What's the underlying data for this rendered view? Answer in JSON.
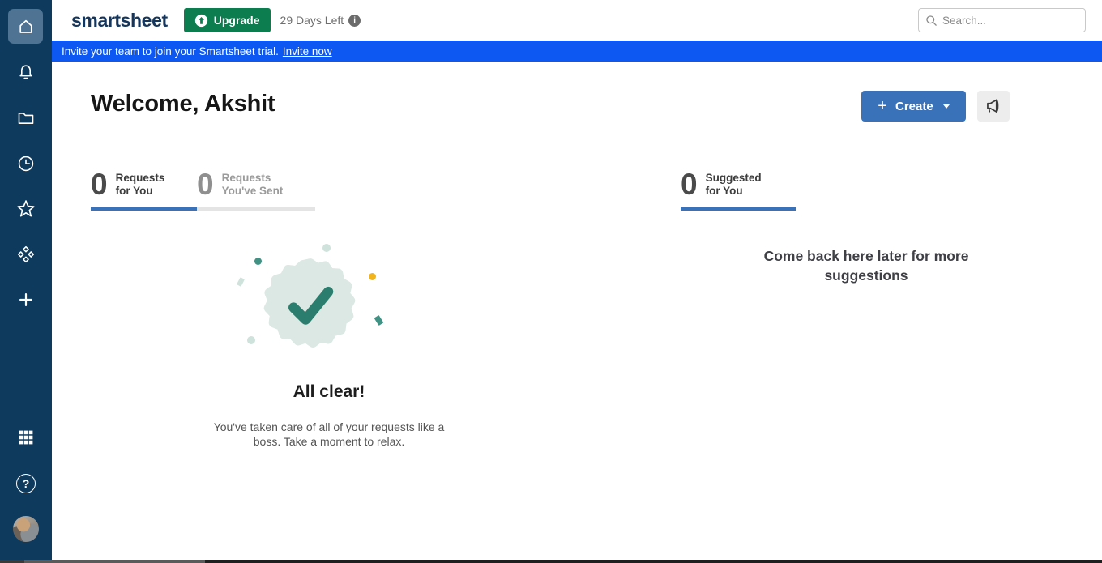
{
  "topbar": {
    "logo": "smartsheet",
    "upgrade_label": "Upgrade",
    "days_left": "29 Days Left",
    "info_glyph": "i",
    "search_placeholder": "Search..."
  },
  "banner": {
    "text": "Invite your team to join your Smartsheet trial.",
    "link_label": "Invite now"
  },
  "sidebar": {
    "items": [
      {
        "icon": "home-icon",
        "active": true
      },
      {
        "icon": "bell-icon",
        "active": false
      },
      {
        "icon": "folder-icon",
        "active": false
      },
      {
        "icon": "clock-icon",
        "active": false
      },
      {
        "icon": "star-icon",
        "active": false
      },
      {
        "icon": "solution-center-icon",
        "active": false
      },
      {
        "icon": "plus-icon",
        "active": false
      }
    ],
    "bottom_items": [
      {
        "icon": "apps-grid-icon"
      },
      {
        "icon": "help-icon",
        "glyph": "?"
      },
      {
        "icon": "user-avatar"
      }
    ]
  },
  "main": {
    "welcome_title": "Welcome, Akshit",
    "create_label": "Create",
    "create_plus": "+",
    "tabs": [
      {
        "count": "0",
        "line1": "Requests",
        "line2": "for You",
        "state": "active"
      },
      {
        "count": "0",
        "line1": "Requests",
        "line2": "You've Sent",
        "state": "inactive"
      },
      {
        "count": "0",
        "line1": "Suggested",
        "line2": "for You",
        "state": "active"
      }
    ],
    "empty_state": {
      "title": "All clear!",
      "body_line1": "You've taken care of all of your requests like a",
      "body_line2": "boss. Take a moment to relax."
    },
    "suggestions_empty": {
      "line1": "Come back here later for more",
      "line2": "suggestions"
    }
  },
  "colors": {
    "sidebar_bg": "#0e3a5e",
    "sidebar_active_bg": "#4f7392",
    "banner_blue": "#0d57f2",
    "upgrade_green": "#0b7d4f",
    "create_blue": "#3a72b9",
    "tab_underline_active": "#3a72b9",
    "tab_underline_inactive": "#e4e4e4",
    "badge_fill": "#dbe8e3",
    "check_teal": "#2b7e6d",
    "confetti_teal": "#3f9284",
    "confetti_mint": "#cfe2dc",
    "confetti_yellow": "#f2b41c"
  }
}
